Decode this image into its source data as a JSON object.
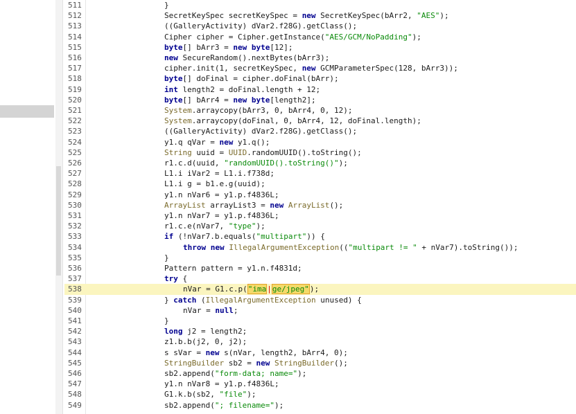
{
  "editor": {
    "lines": [
      {
        "n": "511",
        "indent": 0,
        "tokens": [
          {
            "t": "}",
            "c": "n"
          }
        ]
      },
      {
        "n": "512",
        "indent": 0,
        "tokens": [
          {
            "t": "SecretKeySpec secretKeySpec = ",
            "c": "n"
          },
          {
            "t": "new",
            "c": "kw"
          },
          {
            "t": " SecretKeySpec(bArr2, ",
            "c": "n"
          },
          {
            "t": "\"AES\"",
            "c": "str"
          },
          {
            "t": ");",
            "c": "n"
          }
        ]
      },
      {
        "n": "513",
        "indent": 0,
        "tokens": [
          {
            "t": "((GalleryActivity) dVar2.f28G).getClass();",
            "c": "n"
          }
        ]
      },
      {
        "n": "514",
        "indent": 0,
        "tokens": [
          {
            "t": "Cipher cipher = Cipher.getInstance(",
            "c": "n"
          },
          {
            "t": "\"AES/GCM/NoPadding\"",
            "c": "str"
          },
          {
            "t": ");",
            "c": "n"
          }
        ]
      },
      {
        "n": "515",
        "indent": 0,
        "tokens": [
          {
            "t": "byte",
            "c": "kw"
          },
          {
            "t": "[] bArr3 = ",
            "c": "n"
          },
          {
            "t": "new",
            "c": "kw"
          },
          {
            "t": " ",
            "c": "n"
          },
          {
            "t": "byte",
            "c": "kw"
          },
          {
            "t": "[12];",
            "c": "n"
          }
        ]
      },
      {
        "n": "516",
        "indent": 0,
        "tokens": [
          {
            "t": "new",
            "c": "kw"
          },
          {
            "t": " SecureRandom().nextBytes(bArr3);",
            "c": "n"
          }
        ]
      },
      {
        "n": "517",
        "indent": 0,
        "tokens": [
          {
            "t": "cipher.init(1, secretKeySpec, ",
            "c": "n"
          },
          {
            "t": "new",
            "c": "kw"
          },
          {
            "t": " GCMParameterSpec(128, bArr3));",
            "c": "n"
          }
        ]
      },
      {
        "n": "518",
        "indent": 0,
        "tokens": [
          {
            "t": "byte",
            "c": "kw"
          },
          {
            "t": "[] doFinal = cipher.doFinal(bArr);",
            "c": "n"
          }
        ]
      },
      {
        "n": "519",
        "indent": 0,
        "tokens": [
          {
            "t": "int",
            "c": "kw"
          },
          {
            "t": " length2 = doFinal.length + 12;",
            "c": "n"
          }
        ]
      },
      {
        "n": "520",
        "indent": 0,
        "tokens": [
          {
            "t": "byte",
            "c": "kw"
          },
          {
            "t": "[] bArr4 = ",
            "c": "n"
          },
          {
            "t": "new",
            "c": "kw"
          },
          {
            "t": " ",
            "c": "n"
          },
          {
            "t": "byte",
            "c": "kw"
          },
          {
            "t": "[length2];",
            "c": "n"
          }
        ]
      },
      {
        "n": "521",
        "indent": 0,
        "tokens": [
          {
            "t": "System",
            "c": "cls"
          },
          {
            "t": ".arraycopy(bArr3, 0, bArr4, 0, 12);",
            "c": "n"
          }
        ]
      },
      {
        "n": "522",
        "indent": 0,
        "tokens": [
          {
            "t": "System",
            "c": "cls"
          },
          {
            "t": ".arraycopy(doFinal, 0, bArr4, 12, doFinal.length);",
            "c": "n"
          }
        ]
      },
      {
        "n": "523",
        "indent": 0,
        "tokens": [
          {
            "t": "((GalleryActivity) dVar2.f28G).getClass();",
            "c": "n"
          }
        ]
      },
      {
        "n": "524",
        "indent": 0,
        "tokens": [
          {
            "t": "y1.q qVar = ",
            "c": "n"
          },
          {
            "t": "new",
            "c": "kw"
          },
          {
            "t": " y1.q();",
            "c": "n"
          }
        ]
      },
      {
        "n": "525",
        "indent": 0,
        "tokens": [
          {
            "t": "String",
            "c": "cls"
          },
          {
            "t": " uuid = ",
            "c": "n"
          },
          {
            "t": "UUID",
            "c": "cls"
          },
          {
            "t": ".randomUUID().toString();",
            "c": "n"
          }
        ]
      },
      {
        "n": "526",
        "indent": 0,
        "tokens": [
          {
            "t": "r1.c.d(uuid, ",
            "c": "n"
          },
          {
            "t": "\"randomUUID().toString()\"",
            "c": "str"
          },
          {
            "t": ");",
            "c": "n"
          }
        ]
      },
      {
        "n": "527",
        "indent": 0,
        "tokens": [
          {
            "t": "L1.i iVar2 = L1.i.f738d;",
            "c": "n"
          }
        ]
      },
      {
        "n": "528",
        "indent": 0,
        "tokens": [
          {
            "t": "L1.i g = b1.e.g(uuid);",
            "c": "n"
          }
        ]
      },
      {
        "n": "529",
        "indent": 0,
        "tokens": [
          {
            "t": "y1.n nVar6 = y1.p.f4836L;",
            "c": "n"
          }
        ]
      },
      {
        "n": "530",
        "indent": 0,
        "tokens": [
          {
            "t": "ArrayList",
            "c": "cls"
          },
          {
            "t": " arrayList3 = ",
            "c": "n"
          },
          {
            "t": "new",
            "c": "kw"
          },
          {
            "t": " ",
            "c": "n"
          },
          {
            "t": "ArrayList",
            "c": "cls"
          },
          {
            "t": "();",
            "c": "n"
          }
        ]
      },
      {
        "n": "531",
        "indent": 0,
        "tokens": [
          {
            "t": "y1.n nVar7 = y1.p.f4836L;",
            "c": "n"
          }
        ]
      },
      {
        "n": "532",
        "indent": 0,
        "tokens": [
          {
            "t": "r1.c.e(nVar7, ",
            "c": "n"
          },
          {
            "t": "\"type\"",
            "c": "str"
          },
          {
            "t": ");",
            "c": "n"
          }
        ]
      },
      {
        "n": "533",
        "indent": 0,
        "tokens": [
          {
            "t": "if",
            "c": "kw"
          },
          {
            "t": " (!nVar7.b.equals(",
            "c": "n"
          },
          {
            "t": "\"multipart\"",
            "c": "str"
          },
          {
            "t": ")) {",
            "c": "n"
          }
        ]
      },
      {
        "n": "534",
        "indent": 1,
        "tokens": [
          {
            "t": "throw",
            "c": "kw"
          },
          {
            "t": " ",
            "c": "n"
          },
          {
            "t": "new",
            "c": "kw"
          },
          {
            "t": " ",
            "c": "n"
          },
          {
            "t": "IllegalArgumentException",
            "c": "cls"
          },
          {
            "t": "((",
            "c": "n"
          },
          {
            "t": "\"multipart != \"",
            "c": "str"
          },
          {
            "t": " + nVar7).toString());",
            "c": "n"
          }
        ]
      },
      {
        "n": "535",
        "indent": 0,
        "tokens": [
          {
            "t": "}",
            "c": "n"
          }
        ]
      },
      {
        "n": "536",
        "indent": 0,
        "tokens": [
          {
            "t": "Pattern pattern = y1.n.f4831d;",
            "c": "n"
          }
        ]
      },
      {
        "n": "537",
        "indent": 0,
        "tokens": [
          {
            "t": "try",
            "c": "kw"
          },
          {
            "t": " {",
            "c": "n"
          }
        ]
      },
      {
        "n": "538",
        "indent": 1,
        "highlight": true,
        "tokens": [
          {
            "t": "nVar = G1.c.p(",
            "c": "n"
          },
          {
            "t": "\"ima",
            "c": "strhl"
          },
          {
            "t": "|",
            "c": "caret"
          },
          {
            "t": "ge/jpeg\"",
            "c": "strhl"
          },
          {
            "t": ");",
            "c": "n"
          }
        ]
      },
      {
        "n": "539",
        "indent": 0,
        "tokens": [
          {
            "t": "} ",
            "c": "n"
          },
          {
            "t": "catch",
            "c": "kw"
          },
          {
            "t": " (",
            "c": "n"
          },
          {
            "t": "IllegalArgumentException",
            "c": "cls"
          },
          {
            "t": " unused) {",
            "c": "n"
          }
        ]
      },
      {
        "n": "540",
        "indent": 1,
        "tokens": [
          {
            "t": "nVar = ",
            "c": "n"
          },
          {
            "t": "null",
            "c": "kw"
          },
          {
            "t": ";",
            "c": "n"
          }
        ]
      },
      {
        "n": "541",
        "indent": 0,
        "tokens": [
          {
            "t": "}",
            "c": "n"
          }
        ]
      },
      {
        "n": "542",
        "indent": 0,
        "tokens": [
          {
            "t": "long",
            "c": "kw"
          },
          {
            "t": " j2 = length2;",
            "c": "n"
          }
        ]
      },
      {
        "n": "543",
        "indent": 0,
        "tokens": [
          {
            "t": "z1.b.b(j2, 0, j2);",
            "c": "n"
          }
        ]
      },
      {
        "n": "544",
        "indent": 0,
        "tokens": [
          {
            "t": "s sVar = ",
            "c": "n"
          },
          {
            "t": "new",
            "c": "kw"
          },
          {
            "t": " s(nVar, length2, bArr4, 0);",
            "c": "n"
          }
        ]
      },
      {
        "n": "545",
        "indent": 0,
        "tokens": [
          {
            "t": "StringBuilder",
            "c": "cls"
          },
          {
            "t": " sb2 = ",
            "c": "n"
          },
          {
            "t": "new",
            "c": "kw"
          },
          {
            "t": " ",
            "c": "n"
          },
          {
            "t": "StringBuilder",
            "c": "cls"
          },
          {
            "t": "();",
            "c": "n"
          }
        ]
      },
      {
        "n": "546",
        "indent": 0,
        "tokens": [
          {
            "t": "sb2.append(",
            "c": "n"
          },
          {
            "t": "\"form-data; name=\"",
            "c": "str"
          },
          {
            "t": ");",
            "c": "n"
          }
        ]
      },
      {
        "n": "547",
        "indent": 0,
        "tokens": [
          {
            "t": "y1.n nVar8 = y1.p.f4836L;",
            "c": "n"
          }
        ]
      },
      {
        "n": "548",
        "indent": 0,
        "tokens": [
          {
            "t": "G1.k.b(sb2, ",
            "c": "n"
          },
          {
            "t": "\"file\"",
            "c": "str"
          },
          {
            "t": ");",
            "c": "n"
          }
        ]
      },
      {
        "n": "549",
        "indent": 0,
        "tokens": [
          {
            "t": "sb2.append(",
            "c": "n"
          },
          {
            "t": "\"; filename=\"",
            "c": "str"
          },
          {
            "t": ");",
            "c": "n"
          }
        ]
      }
    ]
  }
}
